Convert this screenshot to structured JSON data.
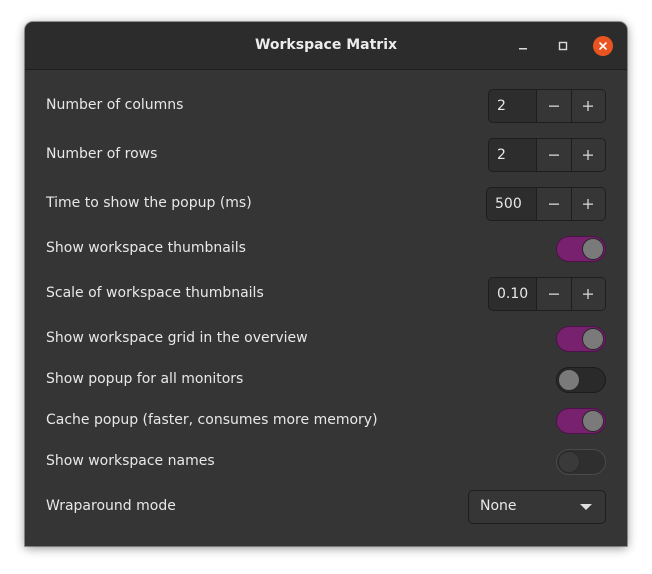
{
  "window": {
    "title": "Workspace Matrix"
  },
  "settings": {
    "columns": {
      "label": "Number of columns",
      "value": "2"
    },
    "rows": {
      "label": "Number of rows",
      "value": "2"
    },
    "popup_time": {
      "label": "Time to show the popup (ms)",
      "value": "500"
    },
    "show_thumbnails": {
      "label": "Show workspace thumbnails",
      "state": "on"
    },
    "thumbnail_scale": {
      "label": "Scale of workspace thumbnails",
      "value": "0.10"
    },
    "show_grid": {
      "label": "Show workspace grid in the overview",
      "state": "on"
    },
    "popup_all_monitors": {
      "label": "Show popup for all monitors",
      "state": "off"
    },
    "cache_popup": {
      "label": "Cache popup (faster, consumes more memory)",
      "state": "on"
    },
    "show_names": {
      "label": "Show workspace names",
      "state": "off"
    },
    "wraparound": {
      "label": "Wraparound mode",
      "value": "None"
    }
  },
  "icons": {
    "minimize": "minimize-icon",
    "maximize": "maximize-icon",
    "close": "close-icon",
    "decrement": "minus-icon",
    "increment": "plus-icon",
    "dropdown": "chevron-down-icon"
  },
  "colors": {
    "window_bg": "#353535",
    "titlebar_bg": "#2c2c2c",
    "switch_on": "#77216f",
    "close_button": "#e95420"
  }
}
